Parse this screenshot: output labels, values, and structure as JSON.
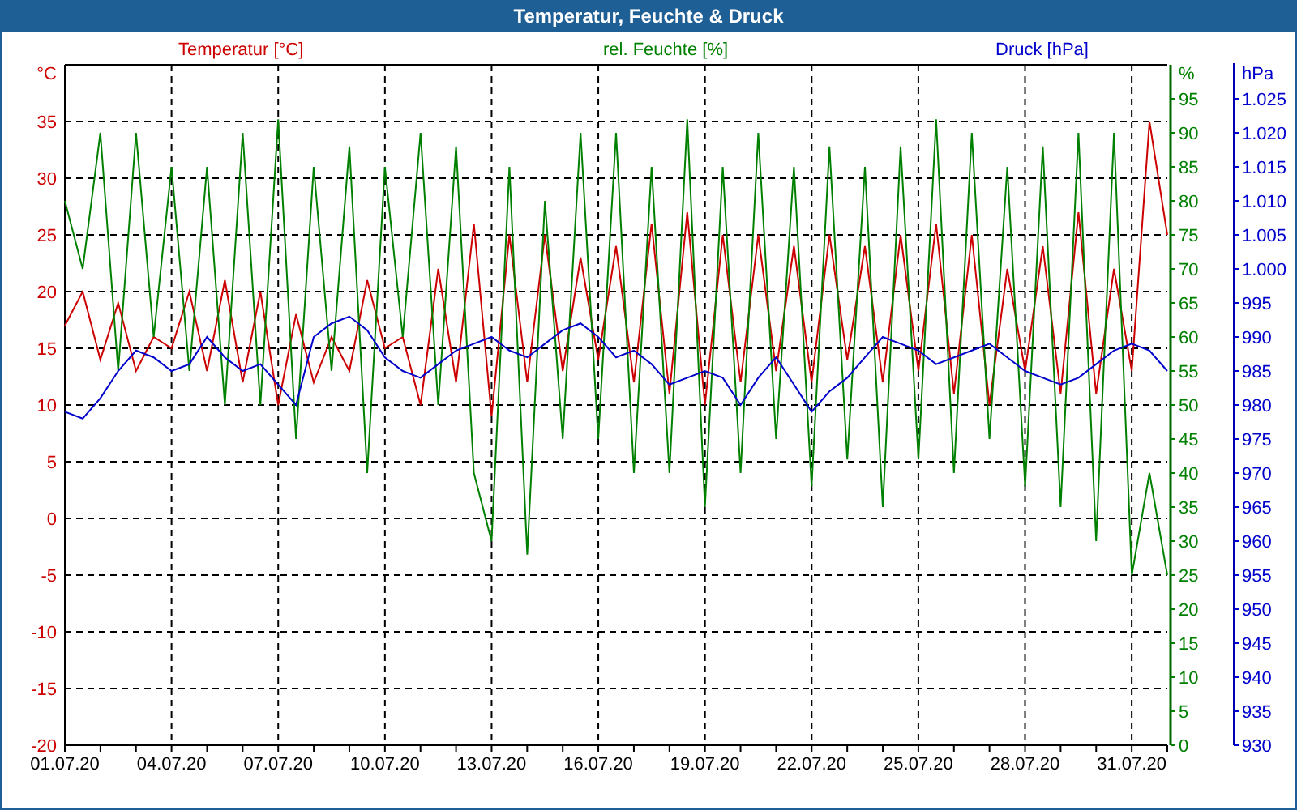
{
  "window": {
    "title": "Temperatur, Feuchte & Druck"
  },
  "charts": [
    {
      "chart_data": {
        "type": "line",
        "title": "Temperatur [°C]",
        "ylabel": "°C",
        "grid": true,
        "categories": [
          "01.07.20",
          null,
          null,
          null,
          null,
          null,
          "04.07.20",
          null,
          null,
          null,
          null,
          null,
          "07.07.20",
          null,
          null,
          null,
          null,
          null,
          "10.07.20",
          null,
          null,
          null,
          null,
          null,
          "13.07.20",
          null,
          null,
          null,
          null,
          null,
          "16.07.20",
          null,
          null,
          null,
          null,
          null,
          "19.07.20",
          null,
          null,
          null,
          null,
          null,
          "22.07.20",
          null,
          null,
          null,
          null,
          null,
          "25.07.20",
          null,
          null,
          null,
          null,
          null,
          "28.07.20",
          null,
          null,
          null,
          null,
          null,
          "31.07.20",
          null,
          null
        ],
        "ylim": [
          -20,
          40
        ],
        "yticks": [
          -20,
          -15,
          -10,
          -5,
          0,
          5,
          10,
          15,
          20,
          25,
          30,
          35
        ],
        "series": [
          {
            "color": "#cc0000",
            "values": [
              17,
              20,
              14,
              19,
              13,
              16,
              15,
              20,
              13,
              21,
              12,
              20,
              10,
              18,
              12,
              16,
              13,
              21,
              15,
              16,
              10,
              22,
              12,
              26,
              9,
              25,
              12,
              25,
              13,
              23,
              14,
              24,
              12,
              26,
              11,
              27,
              10,
              25,
              12,
              25,
              13,
              24,
              12,
              25,
              14,
              24,
              12,
              25,
              13,
              26,
              11,
              25,
              10,
              22,
              13,
              24,
              11,
              27,
              11,
              22,
              13,
              35,
              25
            ]
          }
        ]
      }
    },
    {
      "chart_data": {
        "type": "line",
        "title": "rel. Feuchte [%]",
        "ylabel": "%",
        "ylim": [
          0,
          100
        ],
        "yticks": [
          0,
          5,
          10,
          15,
          20,
          25,
          30,
          35,
          40,
          45,
          50,
          55,
          60,
          65,
          70,
          75,
          80,
          85,
          90,
          95
        ],
        "series": [
          {
            "color": "#008000",
            "values": [
              80,
              70,
              90,
              55,
              90,
              60,
              85,
              55,
              85,
              50,
              90,
              50,
              92,
              45,
              85,
              55,
              88,
              40,
              85,
              60,
              90,
              50,
              88,
              40,
              30,
              85,
              28,
              80,
              45,
              90,
              45,
              90,
              40,
              85,
              40,
              92,
              35,
              85,
              40,
              90,
              45,
              85,
              38,
              88,
              42,
              85,
              35,
              88,
              42,
              92,
              40,
              90,
              45,
              85,
              38,
              88,
              35,
              90,
              30,
              90,
              25,
              40,
              25
            ]
          }
        ]
      }
    },
    {
      "chart_data": {
        "type": "line",
        "title": "Druck [hPa]",
        "ylabel": "hPa",
        "ylim": [
          930,
          1030
        ],
        "yticks": [
          930,
          935,
          940,
          945,
          950,
          955,
          960,
          965,
          970,
          975,
          980,
          985,
          990,
          995,
          {
            "value": 1000,
            "label": "1.000"
          },
          {
            "value": 1005,
            "label": "1.005"
          },
          {
            "value": 1010,
            "label": "1.010"
          },
          {
            "value": 1015,
            "label": "1.015"
          },
          {
            "value": 1020,
            "label": "1.020"
          },
          {
            "value": 1025,
            "label": "1.025"
          }
        ],
        "series": [
          {
            "color": "#0000cc",
            "values": [
              979,
              978,
              981,
              985,
              988,
              987,
              985,
              986,
              990,
              987,
              985,
              986,
              983,
              980,
              990,
              992,
              993,
              991,
              987,
              985,
              984,
              986,
              988,
              989,
              990,
              988,
              987,
              989,
              991,
              992,
              990,
              987,
              988,
              986,
              983,
              984,
              985,
              984,
              980,
              984,
              987,
              983,
              979,
              982,
              984,
              987,
              990,
              989,
              988,
              986,
              987,
              988,
              989,
              987,
              985,
              984,
              983,
              984,
              986,
              988,
              989,
              988,
              985
            ]
          }
        ]
      }
    }
  ]
}
